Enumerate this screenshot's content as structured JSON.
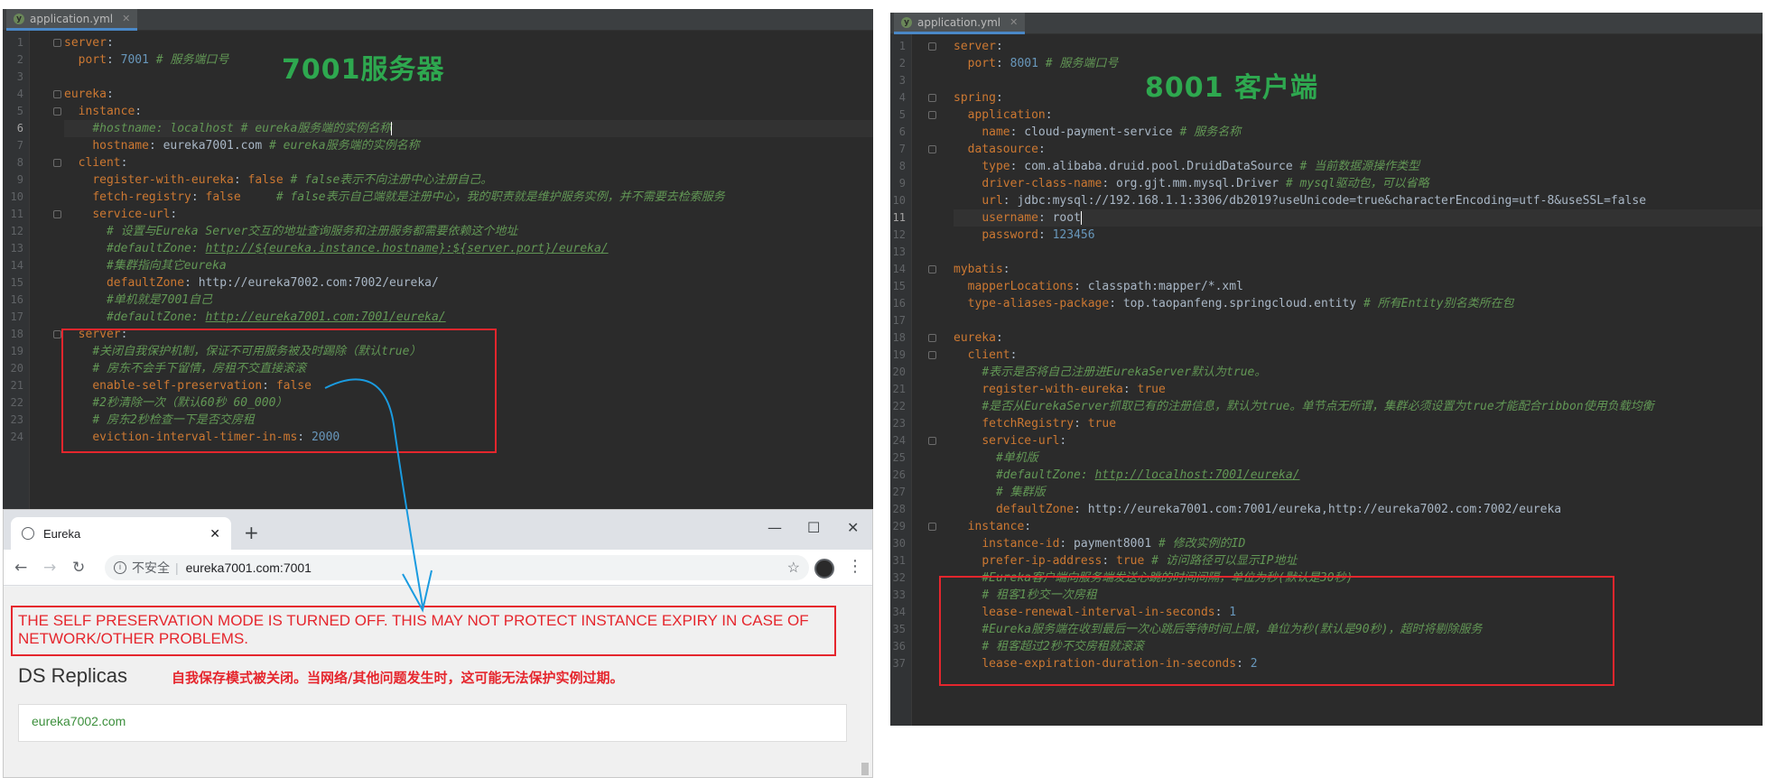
{
  "left_editor": {
    "tab_label": "application.yml",
    "overlay_label": "7001服务器",
    "lines": [
      [
        [
          "k",
          "server"
        ],
        [
          "v",
          ":"
        ]
      ],
      [
        [
          "v",
          "  "
        ],
        [
          "k",
          "port"
        ],
        [
          "v",
          ": "
        ],
        [
          "n",
          "7001"
        ],
        [
          "v",
          " "
        ],
        [
          "c",
          "# 服务端口号"
        ]
      ],
      [],
      [
        [
          "k",
          "eureka"
        ],
        [
          "v",
          ":"
        ]
      ],
      [
        [
          "v",
          "  "
        ],
        [
          "k",
          "instance"
        ],
        [
          "v",
          ":"
        ]
      ],
      [
        [
          "v",
          "    "
        ],
        [
          "c",
          "#hostname: localhost # eureka服务端的实例名称"
        ]
      ],
      [
        [
          "v",
          "    "
        ],
        [
          "k",
          "hostname"
        ],
        [
          "v",
          ": eureka7001.com "
        ],
        [
          "c",
          "# eureka服务端的实例名称"
        ]
      ],
      [
        [
          "v",
          "  "
        ],
        [
          "k",
          "client"
        ],
        [
          "v",
          ":"
        ]
      ],
      [
        [
          "v",
          "    "
        ],
        [
          "k",
          "register-with-eureka"
        ],
        [
          "v",
          ": "
        ],
        [
          "k",
          "false"
        ],
        [
          "v",
          " "
        ],
        [
          "c",
          "# false表示不向注册中心注册自己。"
        ]
      ],
      [
        [
          "v",
          "    "
        ],
        [
          "k",
          "fetch-registry"
        ],
        [
          "v",
          ": "
        ],
        [
          "k",
          "false"
        ],
        [
          "v",
          "     "
        ],
        [
          "c",
          "# false表示自己端就是注册中心，我的职责就是维护服务实例，并不需要去检索服务"
        ]
      ],
      [
        [
          "v",
          "    "
        ],
        [
          "k",
          "service-url"
        ],
        [
          "v",
          ":"
        ]
      ],
      [
        [
          "v",
          "      "
        ],
        [
          "c",
          "# 设置与Eureka Server交互的地址查询服务和注册服务都需要依赖这个地址"
        ]
      ],
      [
        [
          "v",
          "      "
        ],
        [
          "c",
          "#defaultZone: "
        ],
        [
          "cu",
          "http://${eureka.instance.hostname}:${server.port}/eureka/"
        ]
      ],
      [
        [
          "v",
          "      "
        ],
        [
          "c",
          "#集群指向其它eureka"
        ]
      ],
      [
        [
          "v",
          "      "
        ],
        [
          "k",
          "defaultZone"
        ],
        [
          "v",
          ": http://eureka7002.com:7002/eureka/"
        ]
      ],
      [
        [
          "v",
          "      "
        ],
        [
          "c",
          "#单机就是7001自己"
        ]
      ],
      [
        [
          "v",
          "      "
        ],
        [
          "c",
          "#defaultZone: "
        ],
        [
          "cu",
          "http://eureka7001.com:7001/eureka/"
        ]
      ],
      [
        [
          "v",
          "  "
        ],
        [
          "k",
          "server"
        ],
        [
          "v",
          ":"
        ]
      ],
      [
        [
          "v",
          "    "
        ],
        [
          "c",
          "#关闭自我保护机制，保证不可用服务被及时踢除（默认true）"
        ]
      ],
      [
        [
          "v",
          "    "
        ],
        [
          "c",
          "# 房东不会手下留情，房租不交直接滚滚"
        ]
      ],
      [
        [
          "v",
          "    "
        ],
        [
          "k",
          "enable-self-preservation"
        ],
        [
          "v",
          ": "
        ],
        [
          "k",
          "false"
        ]
      ],
      [
        [
          "v",
          "    "
        ],
        [
          "c",
          "#2秒清除一次（默认60秒 60_000）"
        ]
      ],
      [
        [
          "v",
          "    "
        ],
        [
          "c",
          "# 房东2秒检查一下是否交房租"
        ]
      ],
      [
        [
          "v",
          "    "
        ],
        [
          "k",
          "eviction-interval-timer-in-ms"
        ],
        [
          "v",
          ": "
        ],
        [
          "n",
          "2000"
        ]
      ]
    ]
  },
  "right_editor": {
    "tab_label": "application.yml",
    "overlay_label": "8001 客户端",
    "lines": [
      [
        [
          "k",
          "server"
        ],
        [
          "v",
          ":"
        ]
      ],
      [
        [
          "v",
          "  "
        ],
        [
          "k",
          "port"
        ],
        [
          "v",
          ": "
        ],
        [
          "n",
          "8001"
        ],
        [
          "v",
          " "
        ],
        [
          "c",
          "# 服务端口号"
        ]
      ],
      [],
      [
        [
          "k",
          "spring"
        ],
        [
          "v",
          ":"
        ]
      ],
      [
        [
          "v",
          "  "
        ],
        [
          "k",
          "application"
        ],
        [
          "v",
          ":"
        ]
      ],
      [
        [
          "v",
          "    "
        ],
        [
          "k",
          "name"
        ],
        [
          "v",
          ": cloud-payment-service "
        ],
        [
          "c",
          "# 服务名称"
        ]
      ],
      [
        [
          "v",
          "  "
        ],
        [
          "k",
          "datasource"
        ],
        [
          "v",
          ":"
        ]
      ],
      [
        [
          "v",
          "    "
        ],
        [
          "k",
          "type"
        ],
        [
          "v",
          ": com.alibaba.druid.pool.DruidDataSource "
        ],
        [
          "c",
          "# 当前数据源操作类型"
        ]
      ],
      [
        [
          "v",
          "    "
        ],
        [
          "k",
          "driver-class-name"
        ],
        [
          "v",
          ": org.gjt.mm.mysql.Driver "
        ],
        [
          "c",
          "# mysql驱动包，可以省略"
        ]
      ],
      [
        [
          "v",
          "    "
        ],
        [
          "k",
          "url"
        ],
        [
          "v",
          ": jdbc:mysql://192.168.1.1:3306/db2019?useUnicode=true&characterEncoding=utf-8&useSSL=false"
        ]
      ],
      [
        [
          "v",
          "    "
        ],
        [
          "k",
          "username"
        ],
        [
          "v",
          ": root"
        ]
      ],
      [
        [
          "v",
          "    "
        ],
        [
          "k",
          "password"
        ],
        [
          "v",
          ": "
        ],
        [
          "n",
          "123456"
        ]
      ],
      [],
      [
        [
          "k",
          "mybatis"
        ],
        [
          "v",
          ":"
        ]
      ],
      [
        [
          "v",
          "  "
        ],
        [
          "k",
          "mapperLocations"
        ],
        [
          "v",
          ": classpath:mapper/*.xml"
        ]
      ],
      [
        [
          "v",
          "  "
        ],
        [
          "k",
          "type-aliases-package"
        ],
        [
          "v",
          ": top.taopanfeng.springcloud.entity "
        ],
        [
          "c",
          "# 所有Entity别名类所在包"
        ]
      ],
      [],
      [
        [
          "k",
          "eureka"
        ],
        [
          "v",
          ":"
        ]
      ],
      [
        [
          "v",
          "  "
        ],
        [
          "k",
          "client"
        ],
        [
          "v",
          ":"
        ]
      ],
      [
        [
          "v",
          "    "
        ],
        [
          "c",
          "#表示是否将自己注册进EurekaServer默认为true。"
        ]
      ],
      [
        [
          "v",
          "    "
        ],
        [
          "k",
          "register-with-eureka"
        ],
        [
          "v",
          ": "
        ],
        [
          "k",
          "true"
        ]
      ],
      [
        [
          "v",
          "    "
        ],
        [
          "c",
          "#是否从EurekaServer抓取已有的注册信息，默认为true。单节点无所谓，集群必须设置为true才能配合ribbon使用负载均衡"
        ]
      ],
      [
        [
          "v",
          "    "
        ],
        [
          "k",
          "fetchRegistry"
        ],
        [
          "v",
          ": "
        ],
        [
          "k",
          "true"
        ]
      ],
      [
        [
          "v",
          "    "
        ],
        [
          "k",
          "service-url"
        ],
        [
          "v",
          ":"
        ]
      ],
      [
        [
          "v",
          "      "
        ],
        [
          "c",
          "#单机版"
        ]
      ],
      [
        [
          "v",
          "      "
        ],
        [
          "c",
          "#defaultZone: "
        ],
        [
          "cu",
          "http://localhost:7001/eureka/"
        ]
      ],
      [
        [
          "v",
          "      "
        ],
        [
          "c",
          "# 集群版"
        ]
      ],
      [
        [
          "v",
          "      "
        ],
        [
          "k",
          "defaultZone"
        ],
        [
          "v",
          ": http://eureka7001.com:7001/eureka,http://eureka7002.com:7002/eureka"
        ]
      ],
      [
        [
          "v",
          "  "
        ],
        [
          "k",
          "instance"
        ],
        [
          "v",
          ":"
        ]
      ],
      [
        [
          "v",
          "    "
        ],
        [
          "k",
          "instance-id"
        ],
        [
          "v",
          ": payment8001 "
        ],
        [
          "c",
          "# 修改实例的ID"
        ]
      ],
      [
        [
          "v",
          "    "
        ],
        [
          "k",
          "prefer-ip-address"
        ],
        [
          "v",
          ": "
        ],
        [
          "k",
          "true"
        ],
        [
          "v",
          " "
        ],
        [
          "c",
          "# 访问路径可以显示IP地址"
        ]
      ],
      [
        [
          "v",
          "    "
        ],
        [
          "c",
          "#Eureka客户端向服务端发送心跳的时间间隔，单位为秒(默认是30秒)"
        ]
      ],
      [
        [
          "v",
          "    "
        ],
        [
          "c",
          "# 租客1秒交一次房租"
        ]
      ],
      [
        [
          "v",
          "    "
        ],
        [
          "k",
          "lease-renewal-interval-in-seconds"
        ],
        [
          "v",
          ": "
        ],
        [
          "n",
          "1"
        ]
      ],
      [
        [
          "v",
          "    "
        ],
        [
          "c",
          "#Eureka服务端在收到最后一次心跳后等待时间上限，单位为秒(默认是90秒)，超时将剔除服务"
        ]
      ],
      [
        [
          "v",
          "    "
        ],
        [
          "c",
          "# 租客超过2秒不交房租就滚滚"
        ]
      ],
      [
        [
          "v",
          "    "
        ],
        [
          "k",
          "lease-expiration-duration-in-seconds"
        ],
        [
          "v",
          ": "
        ],
        [
          "n",
          "2"
        ]
      ]
    ]
  },
  "browser": {
    "tab_title": "Eureka",
    "new_tab": "+",
    "insecure_label": "不安全",
    "url": "eureka7001.com:7001",
    "warning": "THE SELF PRESERVATION MODE IS TURNED OFF. THIS MAY NOT PROTECT INSTANCE EXPIRY IN CASE OF NETWORK/OTHER PROBLEMS.",
    "section_title": "DS Replicas",
    "annotation": "自我保存模式被关闭。当网络/其他问题发生时，这可能无法保护实例过期。",
    "replica": "eureka7002.com"
  },
  "colors": {
    "annotation_red": "#e5262d",
    "label_green": "#2ea84f",
    "arrow_blue": "#1a9be0"
  }
}
